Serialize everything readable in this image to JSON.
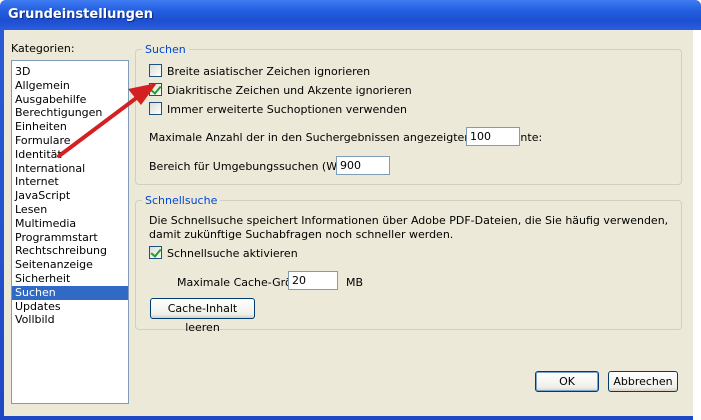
{
  "window": {
    "title": "Grundeinstellungen"
  },
  "categories": {
    "label": "Kategorien:",
    "items": [
      "3D",
      "Allgemein",
      "Ausgabehilfe",
      "Berechtigungen",
      "Einheiten",
      "Formulare",
      "Identität",
      "International",
      "Internet",
      "JavaScript",
      "Lesen",
      "Multimedia",
      "Programmstart",
      "Rechtschreibung",
      "Seitenanzeige",
      "Sicherheit",
      "Suchen",
      "Updates",
      "Vollbild"
    ],
    "selected": "Suchen"
  },
  "suchen": {
    "legend": "Suchen",
    "options": [
      {
        "label": "Breite asiatischer Zeichen ignorieren",
        "checked": false
      },
      {
        "label": "Diakritische Zeichen und Akzente ignorieren",
        "checked": true
      },
      {
        "label": "Immer erweiterte Suchoptionen verwenden",
        "checked": false
      }
    ],
    "max_docs_label": "Maximale Anzahl der in den Suchergebnissen angezeigten Dokumente:",
    "max_docs_value": "100",
    "proximity_label": "Bereich für Umgebungssuchen (Wörter):",
    "proximity_value": "900"
  },
  "schnellsuche": {
    "legend": "Schnellsuche",
    "description": "Die Schnellsuche speichert Informationen über Adobe PDF-Dateien, die Sie häufig verwenden, damit zukünftige Suchabfragen noch schneller werden.",
    "enable_label": "Schnellsuche aktivieren",
    "enable_checked": true,
    "cache_size_label": "Maximale Cache-Größe",
    "cache_size_value": "20",
    "cache_unit": "MB",
    "clear_cache_button": "Cache-Inhalt leeren"
  },
  "buttons": {
    "ok": "OK",
    "cancel": "Abbrechen"
  },
  "colors": {
    "annotation_arrow": "#d42020",
    "selection": "#316ac5",
    "group_legend": "#0046d5"
  }
}
